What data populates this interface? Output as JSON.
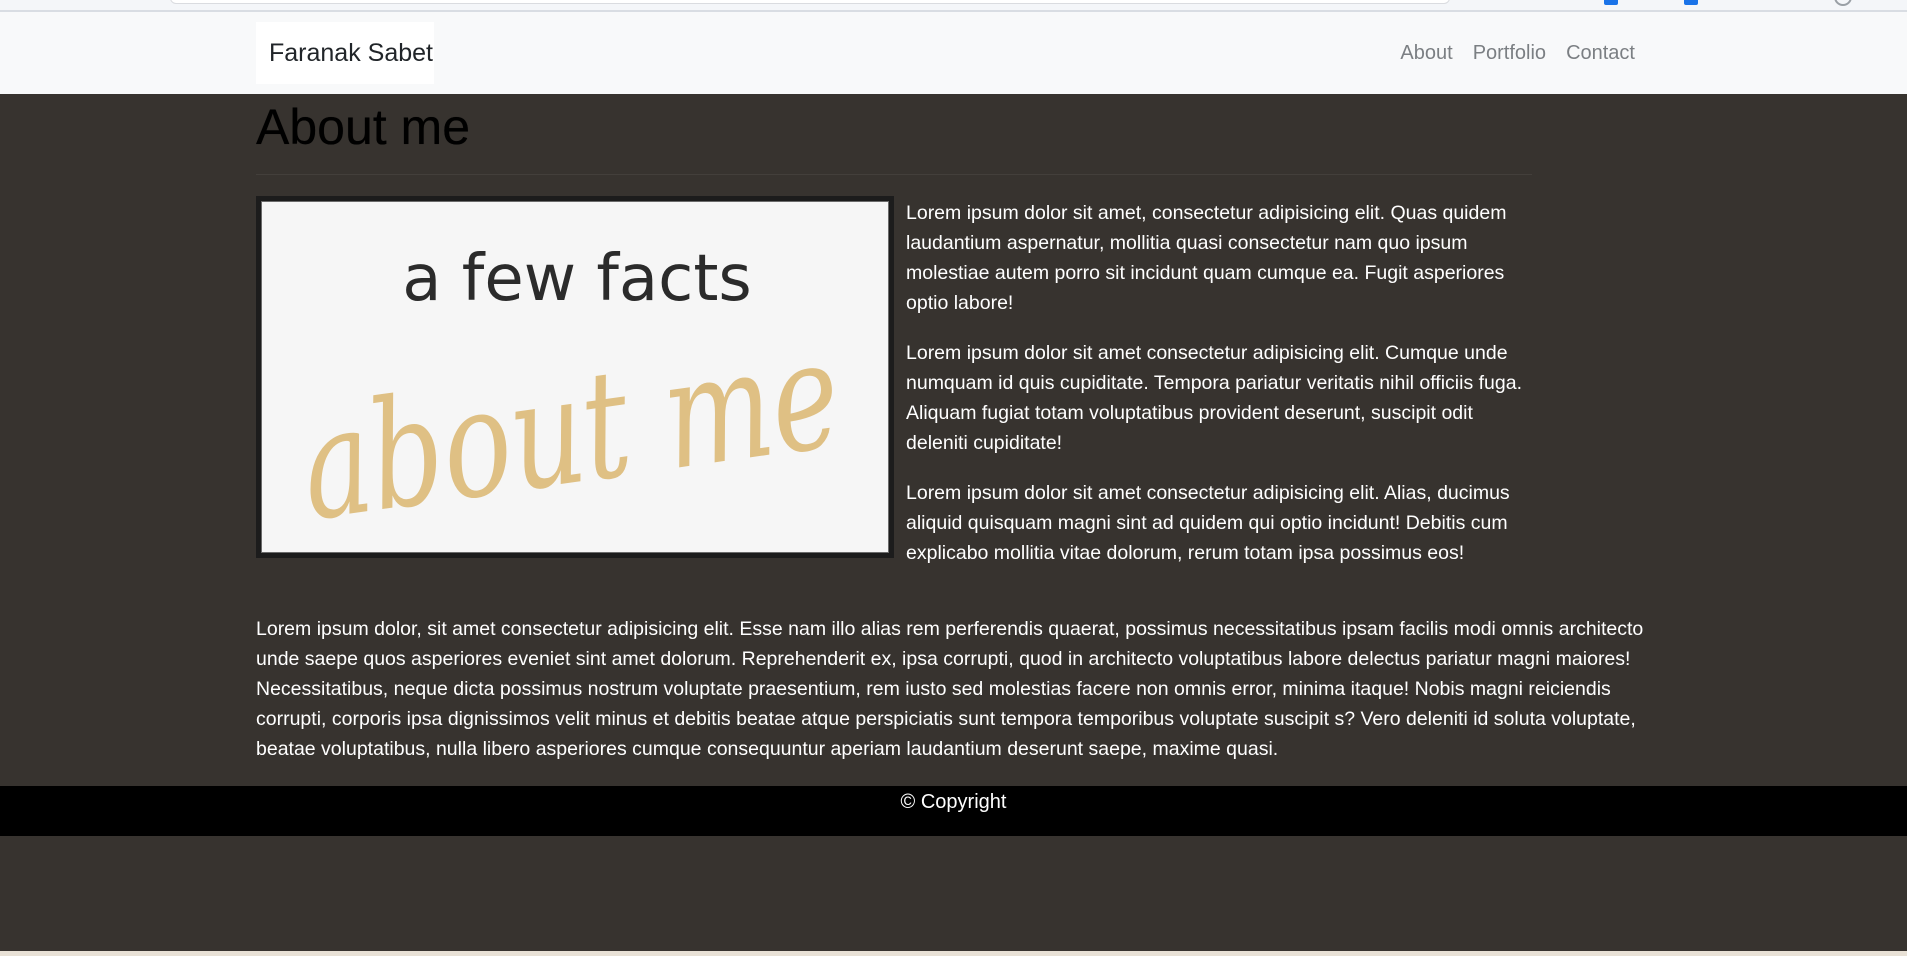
{
  "navbar": {
    "brand": "Faranak Sabet",
    "links": [
      "About",
      "Portfolio",
      "Contact"
    ]
  },
  "main": {
    "title": "About me",
    "image": {
      "line1": "a few facts",
      "line2": "about me"
    },
    "side_paragraphs": [
      "Lorem ipsum dolor sit amet, consectetur adipisicing elit. Quas quidem laudantium aspernatur, mollitia quasi consectetur nam quo ipsum molestiae autem porro sit incidunt quam cumque ea. Fugit asperiores optio labore!",
      "Lorem ipsum dolor sit amet consectetur adipisicing elit. Cumque unde numquam id quis cupiditate. Tempora pariatur veritatis nihil officiis fuga. Aliquam fugiat totam voluptatibus provident deserunt, suscipit odit deleniti cupiditate!",
      "Lorem ipsum dolor sit amet consectetur adipisicing elit. Alias, ducimus aliquid quisquam magni sint ad quidem qui optio incidunt! Debitis cum explicabo mollitia vitae dolorum, rerum totam ipsa possimus eos!"
    ],
    "full_paragraph": "Lorem ipsum dolor, sit amet consectetur adipisicing elit. Esse nam illo alias rem perferendis quaerat, possimus necessitatibus ipsam facilis modi omnis architecto unde saepe quos asperiores eveniet sint amet dolorum. Reprehenderit ex, ipsa corrupti, quod in architecto voluptatibus labore delectus pariatur magni maiores! Necessitatibus, neque dicta possimus nostrum voluptate praesentium, rem iusto sed molestias facere non omnis error, minima itaque! Nobis magni reiciendis corrupti, corporis ipsa dignissimos velit minus et debitis beatae atque perspiciatis sunt tempora temporibus voluptate suscipit s? Vero deleniti id soluta voluptate, beatae voluptatibus, nulla libero asperiores cumque consequuntur aperiam laudantium deserunt saepe, maxime quasi."
  },
  "footer": {
    "text": "© Copyright"
  },
  "colors": {
    "page_background": "#37332f",
    "navbar_background": "#f8f9fa",
    "nav_link": "#7b7f83",
    "footer_background": "#000000",
    "image_script_gold": "#dfc084"
  }
}
